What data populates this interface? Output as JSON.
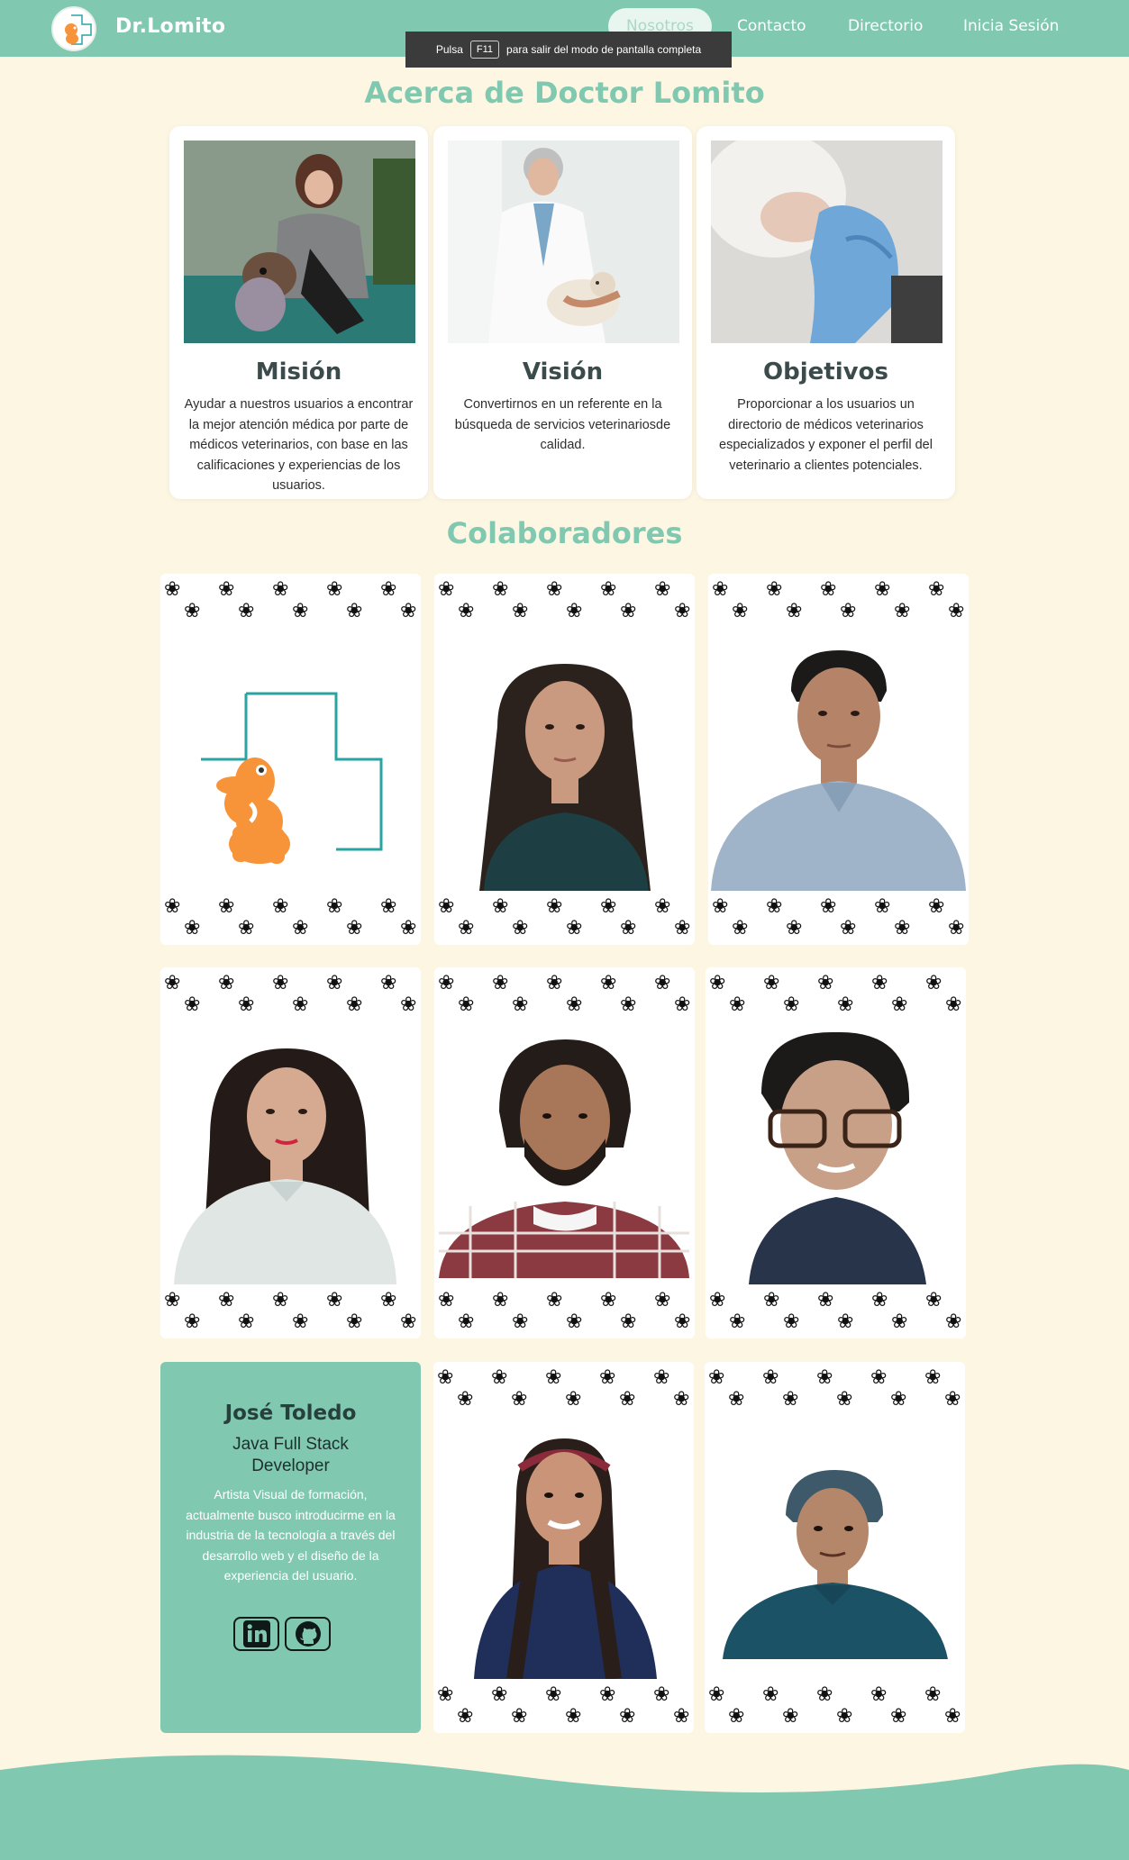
{
  "nav": {
    "brand": "Dr.Lomito",
    "links": [
      {
        "label": "Nosotros",
        "active": true
      },
      {
        "label": "Contacto",
        "active": false
      },
      {
        "label": "Directorio",
        "active": false
      },
      {
        "label": "Inicia Sesión",
        "active": false
      }
    ]
  },
  "fullscreen_tip": {
    "before": "Pulsa",
    "key": "F11",
    "after": "para salir del modo de pantalla completa"
  },
  "about": {
    "title": "Acerca de Doctor Lomito",
    "cards": [
      {
        "heading": "Misión",
        "text": "Ayudar a nuestros usuarios a encontrar la mejor atención médica por parte de médicos veterinarios, con base en las calificaciones y experiencias de los usuarios.",
        "photo": "woman-with-dog-photo"
      },
      {
        "heading": "Visión",
        "text": "Convertirnos en un referente en la búsqueda de servicios veterinariosde calidad.",
        "photo": "vet-with-cat-photo"
      },
      {
        "heading": "Objetivos",
        "text": "Proporcionar a los usuarios un directorio de médicos veterinarios especializados y exponer el perfil del veterinario a clientes potenciales.",
        "photo": "paw-in-gloved-hand-photo"
      }
    ]
  },
  "collaborators": {
    "title": "Colaboradores",
    "featured": {
      "name": "José Toledo",
      "role": "Java Full Stack Developer",
      "bio": "Artista Visual de formación, actualmente busco introducirme en la industria de la tecnología a través del desarrollo web y el diseño de la experiencia del usuario.",
      "links": [
        "linkedin-icon",
        "github-icon"
      ]
    }
  },
  "colors": {
    "accent": "#80c9b0",
    "background": "#fdf6e3",
    "logo_orange": "#f7943a",
    "logo_teal": "#2aa3a3"
  }
}
